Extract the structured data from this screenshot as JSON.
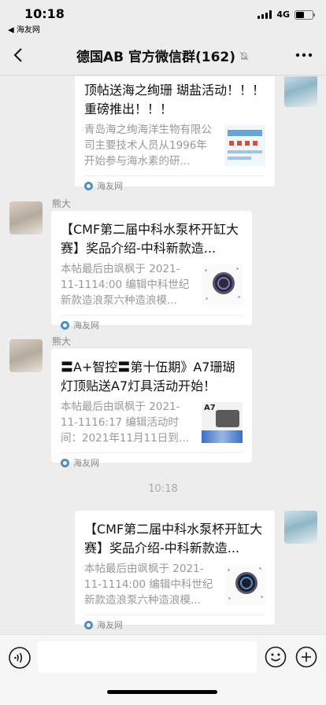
{
  "status_bar": {
    "time": "10:18",
    "back_app": "◀ 海友网",
    "network": "4G"
  },
  "nav": {
    "title": "德国AB 官方微信群(162)"
  },
  "messages": [
    {
      "title": "顶帖送海之绚珊 瑚盐活动！！！ 重磅推出！！！",
      "description": "青岛海之绚海洋生物有限公司主要技术人员从1996年开始参与海水素的研...",
      "source": "海友网"
    },
    {
      "sender": "熊大",
      "title": "【CMF第二届中科水泵杯开缸大赛】奖品介绍-中科新款造...",
      "description": "本帖最后由飒枫于 2021-11-1114:00 编辑中科世纪新款造浪泵六种造浪模...",
      "source": "海友网"
    },
    {
      "sender": "熊大",
      "title": "〓A+智控〓第十伍期》A7珊瑚灯顶贴送A7灯具活动开始！",
      "description": "本帖最后由飒枫于 2021-11-1116:17 编辑活动时间：2021年11月11日到11月...",
      "thumb_label": "A7",
      "source": "海友网"
    },
    {
      "timestamp": "10:18"
    },
    {
      "title": "【CMF第二届中科水泵杯开缸大赛】奖品介绍-中科新款造...",
      "description": "本帖最后由飒枫于 2021-11-1114:00 编辑中科世纪新款造浪泵六种造浪模...",
      "source": "海友网"
    }
  ],
  "input": {
    "value": ""
  }
}
